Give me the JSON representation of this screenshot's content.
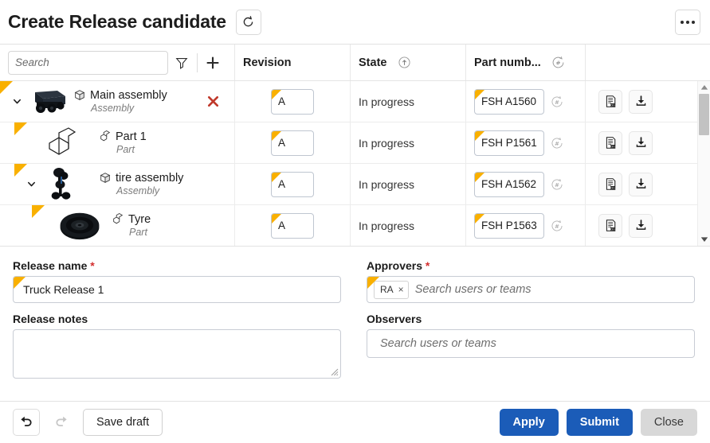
{
  "window": {
    "title": "Create Release candidate",
    "refresh_icon": "refresh-icon",
    "more_icon": "more-options-icon"
  },
  "toolbar": {
    "search_placeholder": "Search",
    "search_value": "",
    "filter_icon": "filter-icon",
    "add_icon": "plus-icon"
  },
  "table": {
    "columns": [
      {
        "key": "tree",
        "label": ""
      },
      {
        "key": "rev",
        "label": "Revision",
        "icon": ""
      },
      {
        "key": "state",
        "label": "State",
        "icon": "state-increment-icon"
      },
      {
        "key": "part",
        "label": "Part numb...",
        "icon": "part-number-generate-icon"
      },
      {
        "key": "act",
        "label": ""
      }
    ],
    "rows": [
      {
        "name": "Main assembly",
        "type": "Assembly",
        "type_icon": "assembly-icon",
        "thumbnail": "truck-thumbnail",
        "indent": 0,
        "expanded": true,
        "has_chevron": true,
        "deletable": true,
        "revision": "A",
        "state": "In progress",
        "part_number": "FSH A1560",
        "actions": [
          "report-icon",
          "download-icon"
        ]
      },
      {
        "name": "Part 1",
        "type": "Part",
        "type_icon": "part-icon",
        "thumbnail": "lshape-thumbnail",
        "indent": 1,
        "expanded": false,
        "has_chevron": false,
        "deletable": false,
        "revision": "A",
        "state": "In progress",
        "part_number": "FSH P1561",
        "actions": [
          "report-icon",
          "download-icon"
        ]
      },
      {
        "name": "tire assembly",
        "type": "Assembly",
        "type_icon": "assembly-icon",
        "thumbnail": "axle-thumbnail",
        "indent": 1,
        "expanded": true,
        "has_chevron": true,
        "deletable": false,
        "revision": "A",
        "state": "In progress",
        "part_number": "FSH A1562",
        "actions": [
          "report-icon",
          "download-icon"
        ]
      },
      {
        "name": "Tyre",
        "type": "Part",
        "type_icon": "part-icon",
        "thumbnail": "tyre-thumbnail",
        "indent": 2,
        "expanded": false,
        "has_chevron": false,
        "deletable": false,
        "revision": "A",
        "state": "In progress",
        "part_number": "FSH P1563",
        "actions": [
          "report-icon",
          "download-icon"
        ]
      }
    ],
    "scrollbar": {
      "up_icon": "scroll-up-arrow",
      "down_icon": "scroll-down-arrow"
    }
  },
  "form": {
    "release_name": {
      "label": "Release name",
      "required": "*",
      "value": "Truck Release 1"
    },
    "release_notes": {
      "label": "Release notes",
      "value": ""
    },
    "approvers": {
      "label": "Approvers",
      "required": "*",
      "placeholder": "Search users or teams",
      "chips": [
        {
          "label": "RA",
          "remove": "×"
        }
      ]
    },
    "observers": {
      "label": "Observers",
      "placeholder": "Search users or teams",
      "value": ""
    }
  },
  "footer": {
    "undo_icon": "undo-icon",
    "redo_icon": "redo-icon",
    "save_draft": "Save draft",
    "apply": "Apply",
    "submit": "Submit",
    "close": "Close"
  },
  "colors": {
    "accent_yellow": "#F9B000",
    "primary_blue": "#1b5cb8",
    "danger_red": "#c0392b",
    "required_red": "#d32f2f",
    "grey_button": "#d8d8d8"
  }
}
